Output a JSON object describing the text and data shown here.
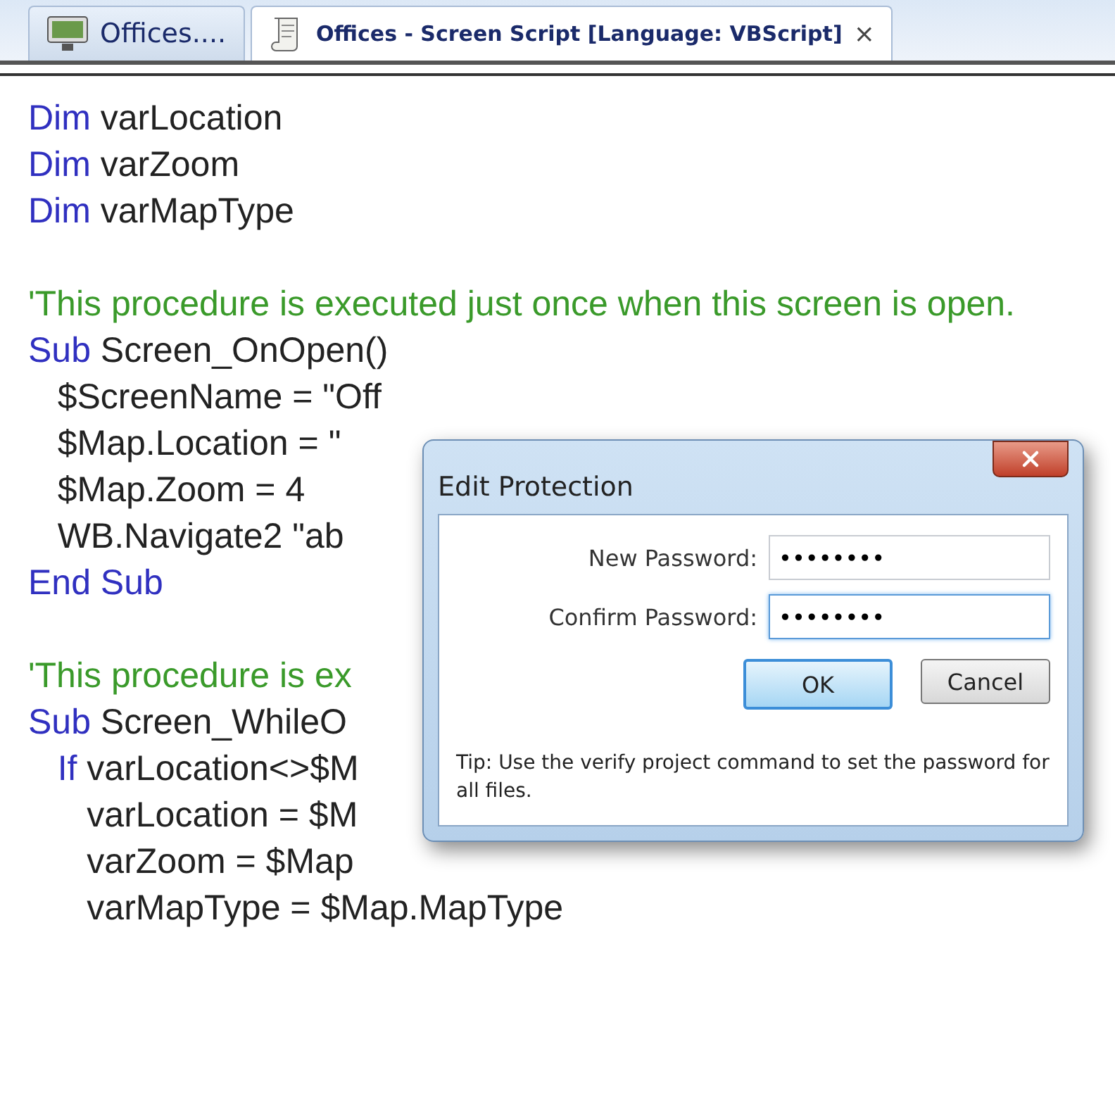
{
  "tabs": [
    {
      "label": "Offices....",
      "selected": false
    },
    {
      "label": "Offices - Screen Script [Language: VBScript]",
      "selected": true,
      "close": "×"
    }
  ],
  "editor": {
    "lines": [
      {
        "tokens": [
          {
            "kind": "keyword",
            "text": "Dim"
          },
          {
            "kind": "plain",
            "text": " varLocation"
          }
        ]
      },
      {
        "tokens": [
          {
            "kind": "keyword",
            "text": "Dim"
          },
          {
            "kind": "plain",
            "text": " varZoom"
          }
        ]
      },
      {
        "tokens": [
          {
            "kind": "keyword",
            "text": "Dim"
          },
          {
            "kind": "plain",
            "text": " varMapType"
          }
        ]
      },
      {
        "kind": "blank"
      },
      {
        "tokens": [
          {
            "kind": "comment",
            "text": "'This procedure is executed just once when this screen is open."
          }
        ]
      },
      {
        "tokens": [
          {
            "kind": "keyword",
            "text": "Sub"
          },
          {
            "kind": "plain",
            "text": " Screen_OnOpen()"
          }
        ]
      },
      {
        "tokens": [
          {
            "kind": "plain",
            "text": "   $ScreenName = \"Off"
          }
        ]
      },
      {
        "tokens": [
          {
            "kind": "plain",
            "text": "   $Map.Location = \""
          }
        ]
      },
      {
        "tokens": [
          {
            "kind": "plain",
            "text": "   $Map.Zoom = 4"
          }
        ]
      },
      {
        "tokens": [
          {
            "kind": "plain",
            "text": "   WB.Navigate2 \"ab"
          }
        ]
      },
      {
        "tokens": [
          {
            "kind": "keyword",
            "text": "End Sub"
          }
        ]
      },
      {
        "kind": "blank"
      },
      {
        "tokens": [
          {
            "kind": "comment",
            "text": "'This procedure is ex"
          }
        ]
      },
      {
        "tokens": [
          {
            "kind": "keyword",
            "text": "Sub"
          },
          {
            "kind": "plain",
            "text": " Screen_WhileO"
          }
        ]
      },
      {
        "tokens": [
          {
            "kind": "keyword",
            "text": "   If"
          },
          {
            "kind": "plain",
            "text": " varLocation<>$M"
          }
        ]
      },
      {
        "tokens": [
          {
            "kind": "plain",
            "text": "      varLocation = $M"
          }
        ]
      },
      {
        "tokens": [
          {
            "kind": "plain",
            "text": "      varZoom = $Map"
          }
        ]
      },
      {
        "tokens": [
          {
            "kind": "plain",
            "text": "      varMapType = $Map.MapType"
          }
        ]
      }
    ]
  },
  "dialog": {
    "title": "Edit Protection",
    "fields": [
      {
        "label": "New Password:",
        "value": "••••••••",
        "focused": false
      },
      {
        "label": "Confirm Password:",
        "value": "••••••••",
        "focused": true
      }
    ],
    "buttons": [
      {
        "label": "OK",
        "default": true
      },
      {
        "label": "Cancel",
        "default": false
      }
    ],
    "tip": "Tip: Use the verify project command to set the password for all files."
  }
}
